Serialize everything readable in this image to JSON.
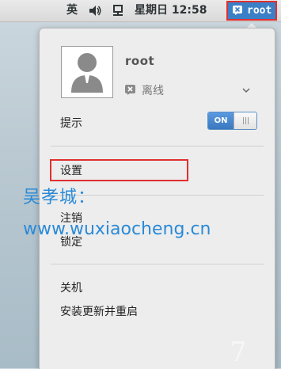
{
  "topbar": {
    "input_method": "英",
    "volume_icon": "speaker-icon",
    "network_icon": "network-wired-icon",
    "clock": "星期日 12:58",
    "user_label": "root"
  },
  "menu": {
    "username": "root",
    "status_label": "离线",
    "status_icon": "offline-x-icon",
    "notifications_label": "提示",
    "notifications_toggle": "ON",
    "items": {
      "settings": "设置",
      "logout": "注销",
      "lock": "锁定",
      "shutdown": "关机",
      "install_updates_restart": "安装更新并重启"
    }
  },
  "watermark": {
    "line1": "吴孝城：",
    "line2": "www.wuxiaocheng.cn"
  },
  "colors": {
    "accent": "#3b80c7",
    "highlight_border": "#e03030",
    "watermark": "#2a8ad8"
  }
}
